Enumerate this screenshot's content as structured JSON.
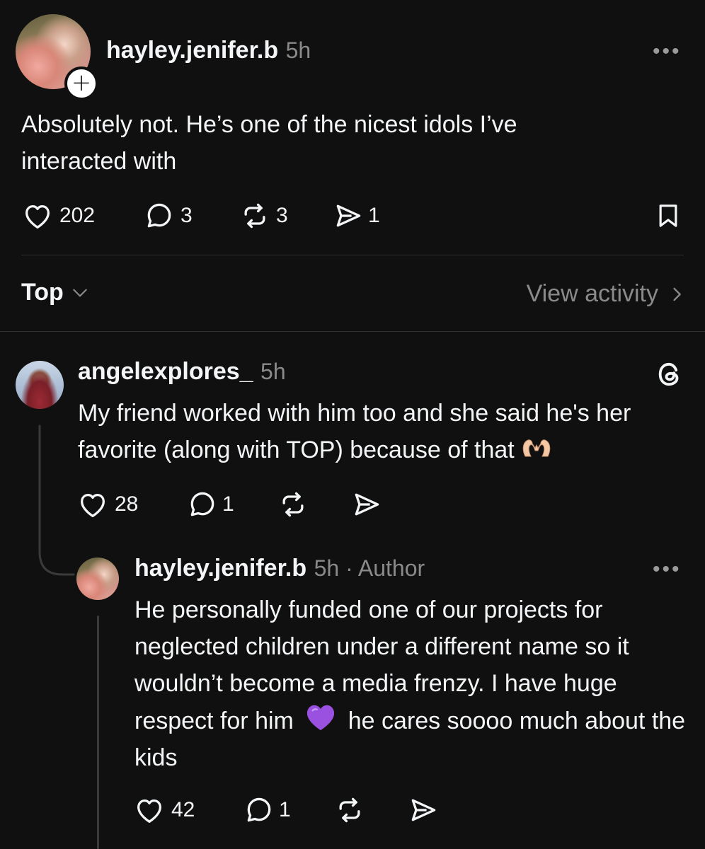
{
  "post": {
    "username": "hayley.jenifer.b",
    "time": "5h",
    "text": "Absolutely not. He’s one of the nicest idols I’ve interacted with",
    "likes": "202",
    "replies": "3",
    "reposts": "3",
    "shares": "1"
  },
  "sort": {
    "label": "Top",
    "view_activity": "View activity"
  },
  "reply1": {
    "username": "angelexplores_",
    "time": "5h",
    "text": "My friend worked with him too and she said he's her favorite (along with TOP) because of that",
    "likes": "28",
    "replies": "1"
  },
  "reply2": {
    "username": "hayley.jenifer.b",
    "time": "5h · Author",
    "text_part1": "He personally funded one of our projects for neglected children under a different name so it wouldn’t become a media frenzy. I have huge respect for him",
    "text_part2": "he cares soooo much about the kids",
    "likes": "42",
    "replies": "1"
  },
  "icons": {
    "like": "heart-icon",
    "reply": "comment-icon",
    "repost": "repost-icon",
    "share": "send-icon",
    "save": "bookmark-icon",
    "more": "more-dots-icon",
    "threads": "threads-logo-icon",
    "emoji_heart_hands": "heart-hands-emoji",
    "emoji_purple_heart": "purple-heart-emoji"
  },
  "colors": {
    "background": "#101010",
    "text": "#f3f5f7",
    "muted": "#8a8a8a",
    "purple_heart": "#9b51e0"
  }
}
